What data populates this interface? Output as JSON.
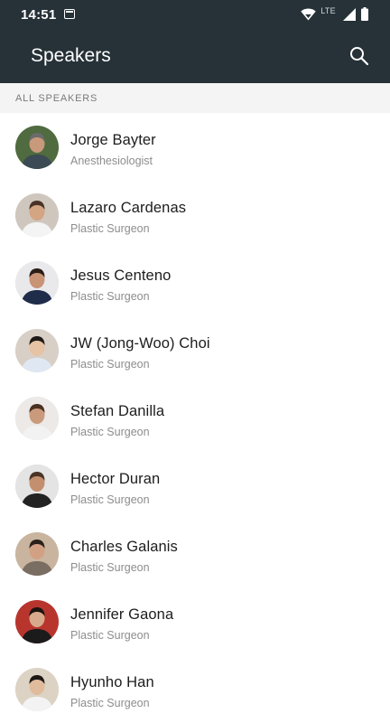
{
  "status_bar": {
    "time": "14:51",
    "network": "LTE",
    "icons": [
      "calendar-icon",
      "wifi-icon",
      "signal-icon",
      "battery-icon"
    ]
  },
  "app_bar": {
    "title": "Speakers",
    "search_icon": "search-icon",
    "background_color": "#263238"
  },
  "section": {
    "label": "ALL SPEAKERS"
  },
  "speakers": [
    {
      "name": "Jorge Bayter",
      "role": "Anesthesiologist",
      "avatar_bg": "#4f6b3f",
      "skin": "#c8997a",
      "shirt": "#3b4a55",
      "hair": "#6b6b6b"
    },
    {
      "name": "Lazaro Cardenas",
      "role": "Plastic Surgeon",
      "avatar_bg": "#cfc7bd",
      "skin": "#d3a583",
      "shirt": "#f4f4f4",
      "hair": "#4a3326"
    },
    {
      "name": "Jesus  Centeno",
      "role": "Plastic Surgeon",
      "avatar_bg": "#e9e9ec",
      "skin": "#c99376",
      "shirt": "#1f2c4a",
      "hair": "#2a1d16"
    },
    {
      "name": "JW (Jong-Woo)  Choi",
      "role": "Plastic Surgeon",
      "avatar_bg": "#d8cfc6",
      "skin": "#e6c3a4",
      "shirt": "#dfe8f2",
      "hair": "#1e1a18"
    },
    {
      "name": "Stefan  Danilla",
      "role": "Plastic Surgeon",
      "avatar_bg": "#ece9e6",
      "skin": "#c99a7b",
      "shirt": "#f2f2f2",
      "hair": "#4a3120"
    },
    {
      "name": "Hector  Duran",
      "role": "Plastic Surgeon",
      "avatar_bg": "#e4e4e4",
      "skin": "#c48f6e",
      "shirt": "#222222",
      "hair": "#4a3526"
    },
    {
      "name": "Charles  Galanis",
      "role": "Plastic Surgeon",
      "avatar_bg": "#c9b59f",
      "skin": "#d2a184",
      "shirt": "#7a6d62",
      "hair": "#2b211b"
    },
    {
      "name": "Jennifer Gaona",
      "role": "Plastic Surgeon",
      "avatar_bg": "#b8352e",
      "skin": "#d8aa8d",
      "shirt": "#1b1b1b",
      "hair": "#1c1410"
    },
    {
      "name": "Hyunho Han",
      "role": "Plastic Surgeon",
      "avatar_bg": "#ddd3c4",
      "skin": "#e0bb9c",
      "shirt": "#f3f3f3",
      "hair": "#1d1915"
    }
  ]
}
